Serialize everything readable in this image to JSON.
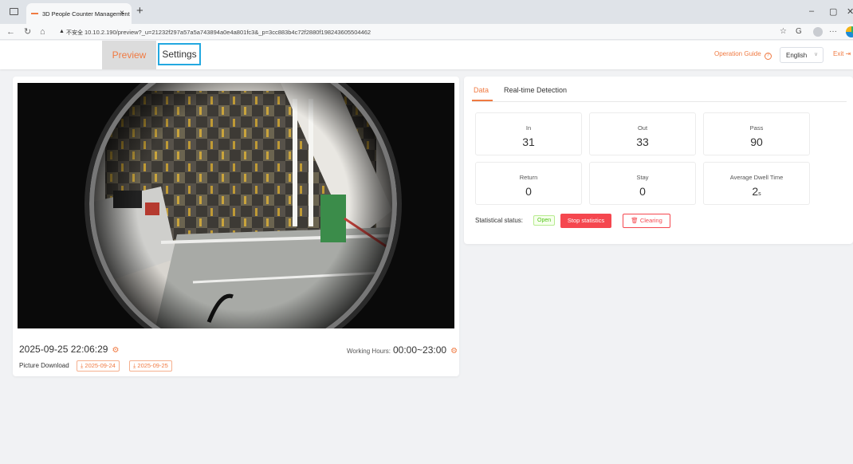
{
  "browser": {
    "tab_title": "3D People Counter Management",
    "tab_close": "×",
    "new_tab": "+",
    "security_label": "不安全",
    "url": "10.10.2.190/preview?_u=21232f297a57a5a743894a0e4a801fc3&_p=3cc883b4c72f2880f198243605504462"
  },
  "header": {
    "nav": {
      "preview": "Preview",
      "settings": "Settings"
    },
    "operation_guide": "Operation Guide",
    "language": "English",
    "exit": "Exit"
  },
  "camera": {
    "datetime": "2025-09-25 22:06:29",
    "working_hours_label": "Working Hours:",
    "working_hours_value": "00:00~23:00",
    "picture_download_label": "Picture Download",
    "downloads": [
      "2025-09-24",
      "2025-09-25"
    ]
  },
  "data_panel": {
    "tabs": {
      "data": "Data",
      "realtime": "Real-time Detection"
    },
    "stats": [
      {
        "label": "In",
        "value": "31",
        "unit": ""
      },
      {
        "label": "Out",
        "value": "33",
        "unit": ""
      },
      {
        "label": "Pass",
        "value": "90",
        "unit": ""
      },
      {
        "label": "Return",
        "value": "0",
        "unit": ""
      },
      {
        "label": "Stay",
        "value": "0",
        "unit": ""
      },
      {
        "label": "Average Dwell Time",
        "value": "2",
        "unit": "s"
      }
    ],
    "statistical_status_label": "Statistical status:",
    "statistical_status_value": "Open",
    "stop_button": "Stop statistics",
    "clear_button": "Clearing"
  },
  "colors": {
    "accent": "#f07a42",
    "danger": "#f5474f",
    "success": "#52c41a",
    "focus_outline": "#23a8e0"
  }
}
